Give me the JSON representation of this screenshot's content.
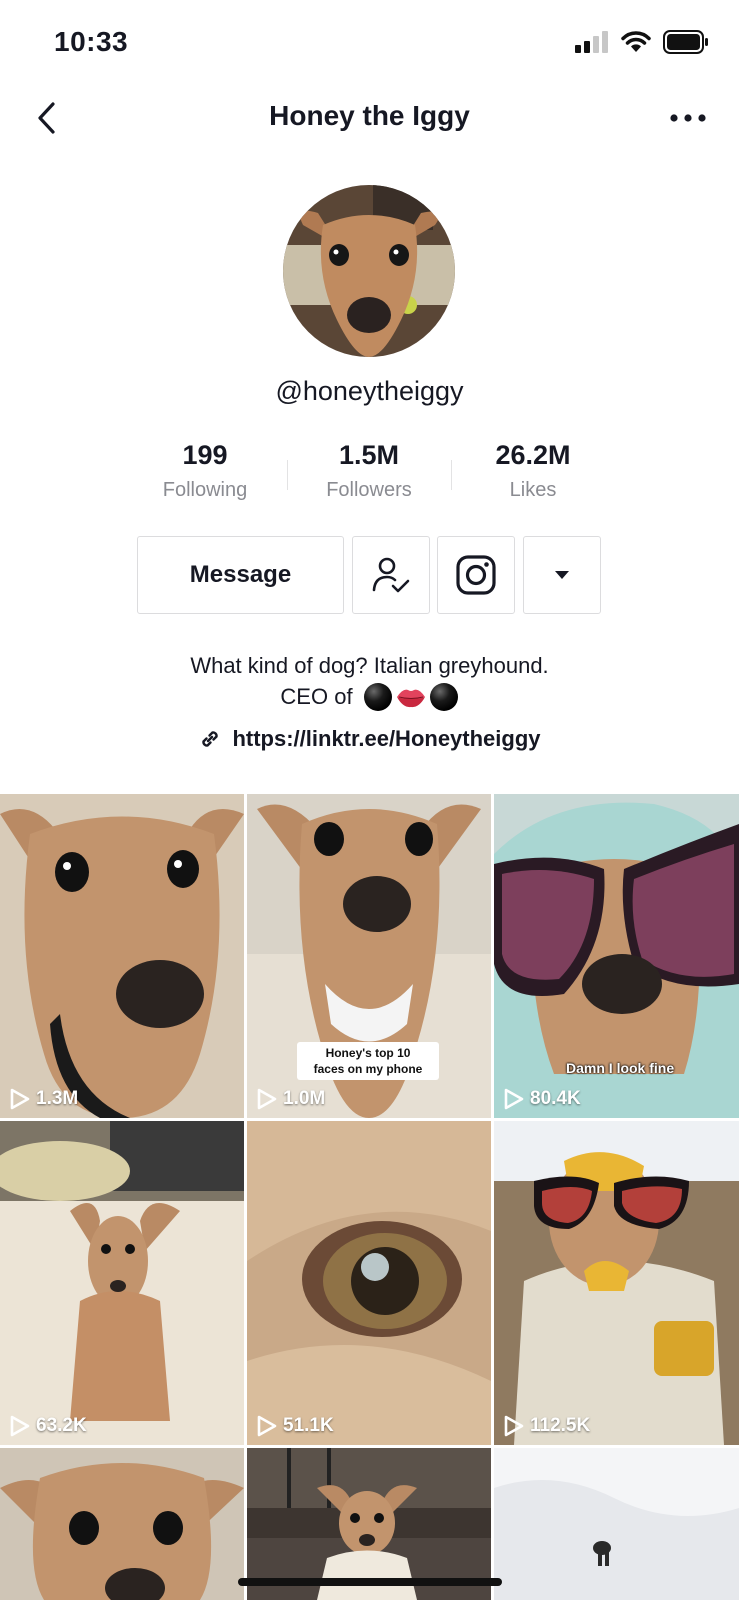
{
  "status": {
    "time": "10:33"
  },
  "nav": {
    "title": "Honey the Iggy",
    "back_icon": "chevron-left-icon",
    "more_icon": "ellipsis-icon"
  },
  "profile": {
    "username": "@honeytheiggy"
  },
  "stats": [
    {
      "value": "199",
      "label": "Following"
    },
    {
      "value": "1.5M",
      "label": "Followers"
    },
    {
      "value": "26.2M",
      "label": "Likes"
    }
  ],
  "actions": {
    "message_label": "Message",
    "following_icon": "user-check-icon",
    "instagram_icon": "instagram-icon",
    "dropdown_icon": "caret-down-icon"
  },
  "bio": {
    "line1": "What kind of dog? Italian greyhound.",
    "line2_prefix": "CEO of"
  },
  "link": {
    "url": "https://linktr.ee/Honeytheiggy"
  },
  "videos": [
    {
      "views": "1.3M"
    },
    {
      "views": "1.0M",
      "caption_line1": "Honey's top 10",
      "caption_line2": "faces on my phone"
    },
    {
      "views": "80.4K",
      "overlay": "Damn I look fine"
    },
    {
      "views": "63.2K"
    },
    {
      "views": "51.1K"
    },
    {
      "views": "112.5K"
    },
    {},
    {},
    {}
  ],
  "colors": {
    "text": "#161823",
    "muted": "#8a8b91",
    "border": "#dcdcde"
  }
}
